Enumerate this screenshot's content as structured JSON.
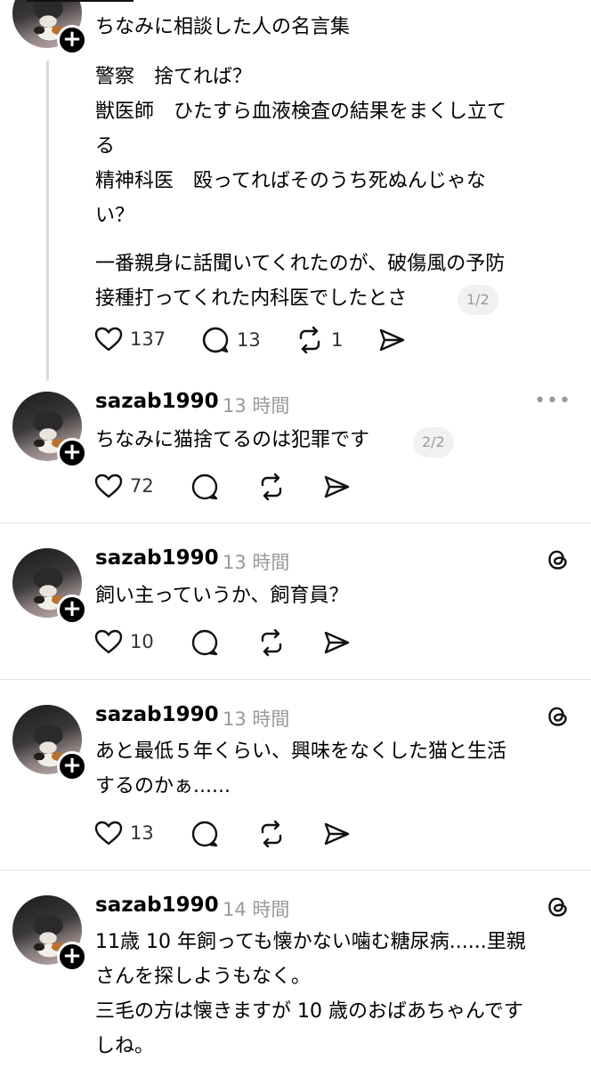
{
  "post1": {
    "text_lines": [
      "ちなみに相談した人の名言集",
      "警察　捨てれば？",
      "獣医師　ひたすら血液検査の結果をまくし立て",
      "る",
      "精神科医　殴ってればそのうち死ぬんじゃな",
      "い？",
      "一番親身に話聞いてくれたのが、破傷風の予防",
      "接種打ってくれた内科医でしたとさ"
    ],
    "page": "1/2",
    "likes": "137",
    "replies": "13",
    "reposts": "1"
  },
  "post2": {
    "username": "sazab1990",
    "time": "13 時間",
    "text": "ちなみに猫捨てるのは犯罪です",
    "page": "2/2",
    "likes": "72"
  },
  "post3": {
    "username": "sazab1990",
    "time": "13 時間",
    "text": "飼い主っていうか、飼育員？",
    "likes": "10"
  },
  "post4": {
    "username": "sazab1990",
    "time": "13 時間",
    "text_lines": [
      "あと最低５年くらい、興味をなくした猫と生活",
      "するのかぁ......"
    ],
    "likes": "13"
  },
  "post5": {
    "username": "sazab1990",
    "time": "14 時間",
    "text_lines": [
      "11歳 10 年飼っても懐かない噛む糖尿病......里親",
      "さんを探しようもなく。",
      "三毛の方は懐きますが 10 歳のおばあちゃんです",
      "しね。"
    ]
  },
  "icons": {
    "like": "heart-icon",
    "reply": "comment-bubble-icon",
    "repost": "repost-arrows-icon",
    "share": "send-icon",
    "follow": "plus-icon",
    "menu": "more-dots-icon",
    "brand": "threads-logo-icon"
  }
}
